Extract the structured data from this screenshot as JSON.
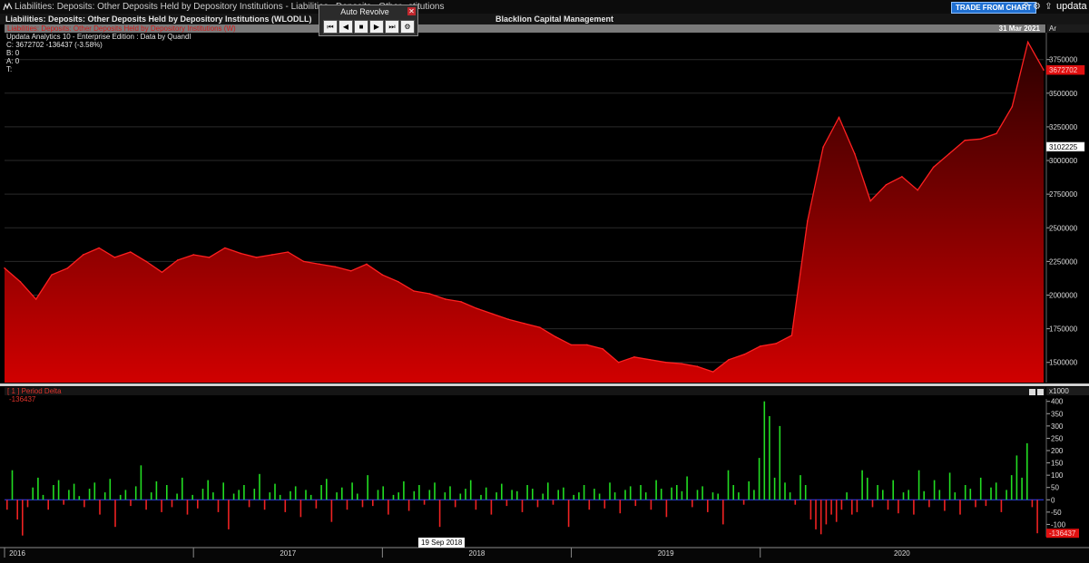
{
  "window": {
    "title": "Liabilities: Deposits: Other Deposits Held by Depository Institutions - Liabilities_ Deposits_ Other",
    "title_tail": "stitutions",
    "trade_button": "TRADE FROM CHART",
    "brand": "updata"
  },
  "header": {
    "chart_title": "Liabilities: Deposits: Other Deposits Held by Depository Institutions (WLODLL)",
    "company": "Blacklion Capital Management"
  },
  "toolbar": {
    "title": "Auto Revolve",
    "buttons": [
      "⏮",
      "◀",
      "■",
      "▶",
      "⏭",
      "⚙"
    ],
    "close": "✕"
  },
  "main_panel": {
    "series_label": "Liabilities: Deposits: Other Deposits Held by Depository Institutions (W)",
    "date": "31 Mar 2021",
    "axis_header": "Ar",
    "info_lines": [
      "Updata Analytics 10 - Enterprise Edition : Data by Quandl",
      "C: 3672702  -136437 (-3.58%)",
      "B: 0",
      "A: 0",
      "T:"
    ]
  },
  "sub_panel": {
    "series_label": "[ 1 ] Period Delta",
    "value": "-136437",
    "axis_header": "x1000"
  },
  "time_axis": {
    "labels": [
      "2016",
      "2017",
      "2018",
      "2019",
      "2020"
    ],
    "crosshair": "19 Sep 2018"
  },
  "colors": {
    "line": "#ff2020",
    "area_top": "#2a0000",
    "area_bottom": "#d00000",
    "bar_up": "#22dd22",
    "bar_down": "#ee2222",
    "price_tag": "#e01010"
  },
  "chart_data": [
    {
      "type": "area",
      "title": "Liabilities: Deposits: Other Deposits Held by Depository Institutions (W)",
      "ylim": [
        1350000,
        3950000
      ],
      "yticks": [
        1500000,
        1750000,
        2000000,
        2250000,
        2500000,
        2750000,
        3000000,
        3250000,
        3500000,
        3750000
      ],
      "ytick_labels": [
        "1500000",
        "1750000",
        "2000000",
        "2250000",
        "2500000",
        "2750000",
        "3000000",
        "3250000",
        "3500000",
        "3750000"
      ],
      "markers": [
        {
          "value": 3672702,
          "label": "3672702",
          "style": "red"
        },
        {
          "value": 3102225,
          "label": "3102225",
          "style": "white"
        }
      ],
      "x": [
        "2016-01",
        "2016-02",
        "2016-03",
        "2016-04",
        "2016-05",
        "2016-06",
        "2016-07",
        "2016-08",
        "2016-09",
        "2016-10",
        "2016-11",
        "2016-12",
        "2017-01",
        "2017-02",
        "2017-03",
        "2017-04",
        "2017-05",
        "2017-06",
        "2017-07",
        "2017-08",
        "2017-09",
        "2017-10",
        "2017-11",
        "2017-12",
        "2018-01",
        "2018-02",
        "2018-03",
        "2018-04",
        "2018-05",
        "2018-06",
        "2018-07",
        "2018-08",
        "2018-09",
        "2018-10",
        "2018-11",
        "2018-12",
        "2019-01",
        "2019-02",
        "2019-03",
        "2019-04",
        "2019-05",
        "2019-06",
        "2019-07",
        "2019-08",
        "2019-09",
        "2019-10",
        "2019-11",
        "2019-12",
        "2020-01",
        "2020-02",
        "2020-03",
        "2020-04",
        "2020-05",
        "2020-06",
        "2020-07",
        "2020-08",
        "2020-09",
        "2020-10",
        "2020-11",
        "2020-12",
        "2021-01",
        "2021-02",
        "2021-03"
      ],
      "values": [
        2200000,
        2100000,
        1970000,
        2150000,
        2200000,
        2300000,
        2350000,
        2280000,
        2320000,
        2250000,
        2170000,
        2260000,
        2300000,
        2280000,
        2350000,
        2310000,
        2280000,
        2300000,
        2320000,
        2250000,
        2230000,
        2210000,
        2180000,
        2230000,
        2150000,
        2100000,
        2030000,
        2010000,
        1970000,
        1950000,
        1900000,
        1860000,
        1820000,
        1790000,
        1760000,
        1690000,
        1630000,
        1630000,
        1600000,
        1500000,
        1540000,
        1520000,
        1500000,
        1490000,
        1470000,
        1430000,
        1520000,
        1560000,
        1620000,
        1640000,
        1700000,
        2550000,
        3100000,
        3320000,
        3050000,
        2700000,
        2820000,
        2880000,
        2780000,
        2950000,
        3050000,
        3150000,
        3160000,
        3200000,
        3400000,
        3880000,
        3672702
      ]
    },
    {
      "type": "bar",
      "title": "[ 1 ] Period Delta",
      "ylabel": "x1000",
      "ylim": [
        -150,
        410
      ],
      "yticks": [
        -100,
        -50,
        0,
        50,
        100,
        150,
        200,
        250,
        300,
        350,
        400
      ],
      "ytick_labels": [
        "-100",
        "-50",
        "0",
        "50",
        "100",
        "150",
        "200",
        "250",
        "300",
        "350",
        "400"
      ],
      "values": [
        -40,
        120,
        -80,
        -145,
        -30,
        50,
        90,
        20,
        -40,
        60,
        80,
        -20,
        40,
        65,
        15,
        -30,
        45,
        70,
        -60,
        30,
        85,
        -110,
        20,
        40,
        -25,
        55,
        140,
        -40,
        30,
        75,
        -50,
        60,
        -30,
        25,
        90,
        -60,
        20,
        -35,
        45,
        80,
        30,
        -50,
        70,
        -120,
        25,
        40,
        60,
        -30,
        45,
        105,
        -40,
        30,
        65,
        20,
        -50,
        35,
        55,
        -70,
        40,
        20,
        -35,
        60,
        85,
        -90,
        30,
        50,
        -40,
        70,
        25,
        -30,
        100,
        -25,
        40,
        55,
        -60,
        20,
        30,
        75,
        -45,
        35,
        60,
        -20,
        40,
        70,
        -110,
        30,
        55,
        -30,
        25,
        45,
        80,
        -40,
        20,
        50,
        -60,
        30,
        65,
        -25,
        40,
        35,
        -50,
        60,
        45,
        -30,
        25,
        70,
        -20,
        40,
        50,
        -110,
        20,
        30,
        60,
        -40,
        45,
        25,
        -35,
        70,
        30,
        -55,
        40,
        55,
        -25,
        60,
        30,
        -40,
        80,
        45,
        -70,
        50,
        60,
        35,
        95,
        -30,
        40,
        55,
        -50,
        30,
        25,
        -100,
        120,
        60,
        30,
        -20,
        75,
        40,
        170,
        400,
        340,
        90,
        300,
        70,
        30,
        -20,
        100,
        60,
        -80,
        -120,
        -140,
        -100,
        -60,
        -90,
        -40,
        30,
        -60,
        -50,
        120,
        90,
        -30,
        60,
        40,
        -40,
        80,
        -55,
        30,
        40,
        -60,
        120,
        35,
        -30,
        80,
        40,
        -45,
        110,
        30,
        -60,
        60,
        45,
        -30,
        90,
        -25,
        50,
        70,
        -50,
        40,
        100,
        180,
        90,
        230,
        -30,
        -136
      ]
    }
  ]
}
